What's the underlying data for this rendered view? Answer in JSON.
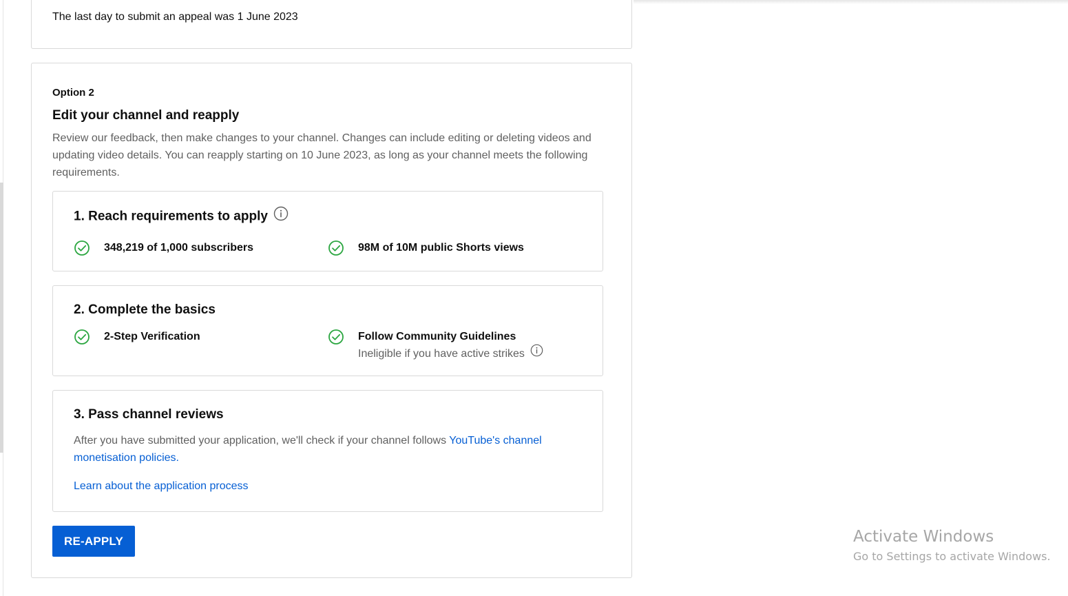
{
  "appeal": {
    "text": "The last day to submit an appeal was 1 June 2023"
  },
  "option": {
    "label": "Option 2",
    "title": "Edit your channel and reapply",
    "description": "Review our feedback, then make changes to your channel. Changes can include editing or deleting videos and updating video details. You can reapply starting on 10 June 2023, as long as your channel meets the following requirements."
  },
  "requirements": [
    {
      "title": "1. Reach requirements to apply",
      "items": [
        {
          "text": "348,219 of 1,000 subscribers",
          "status": "met"
        },
        {
          "text": "98M of 10M public Shorts views",
          "status": "met"
        }
      ]
    },
    {
      "title": "2. Complete the basics",
      "items": [
        {
          "text": "2-Step Verification",
          "status": "met"
        },
        {
          "text": "Follow Community Guidelines",
          "subtext": "Ineligible if you have active strikes",
          "status": "met"
        }
      ]
    },
    {
      "title": "3. Pass channel reviews",
      "description_prefix": "After you have submitted your application, we'll check if your channel follows ",
      "policy_link": "YouTube's channel monetisation policies.",
      "learn_link": "Learn about the application process"
    }
  ],
  "actions": {
    "reapply_label": "RE-APPLY"
  },
  "watermark": {
    "title": "Activate Windows",
    "subtitle": "Go to Settings to activate Windows."
  },
  "colors": {
    "accent": "#065fd4",
    "check": "#2ba640",
    "secondary_text": "#606060",
    "border": "#d9d9d9"
  },
  "icons": {
    "check": "check-circle-icon",
    "info": "info-icon"
  }
}
